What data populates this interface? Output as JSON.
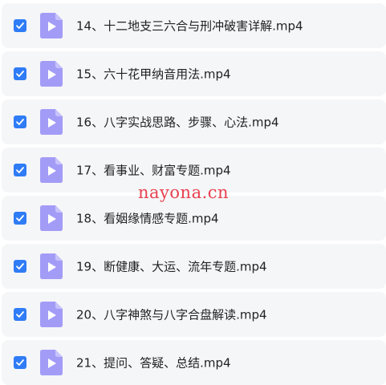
{
  "files": [
    {
      "name": "14、十二地支三六合与刑冲破害详解.mp4",
      "checked": true
    },
    {
      "name": "15、六十花甲纳音用法.mp4",
      "checked": true
    },
    {
      "name": "16、八字实战思路、步骤、心法.mp4",
      "checked": true
    },
    {
      "name": "17、看事业、财富专题.mp4",
      "checked": true
    },
    {
      "name": "18、看姻缘情感专题.mp4",
      "checked": true
    },
    {
      "name": "19、断健康、大运、流年专题.mp4",
      "checked": true
    },
    {
      "name": "20、八字神煞与八字合盘解读.mp4",
      "checked": true
    },
    {
      "name": "21、提问、答疑、总结.mp4",
      "checked": true
    }
  ],
  "watermark": "nayona.cn",
  "colors": {
    "checkbox": "#2f7cf6",
    "icon": "#a39cf7",
    "row_bg": "#f5f6f8",
    "watermark": "#e8414f"
  }
}
